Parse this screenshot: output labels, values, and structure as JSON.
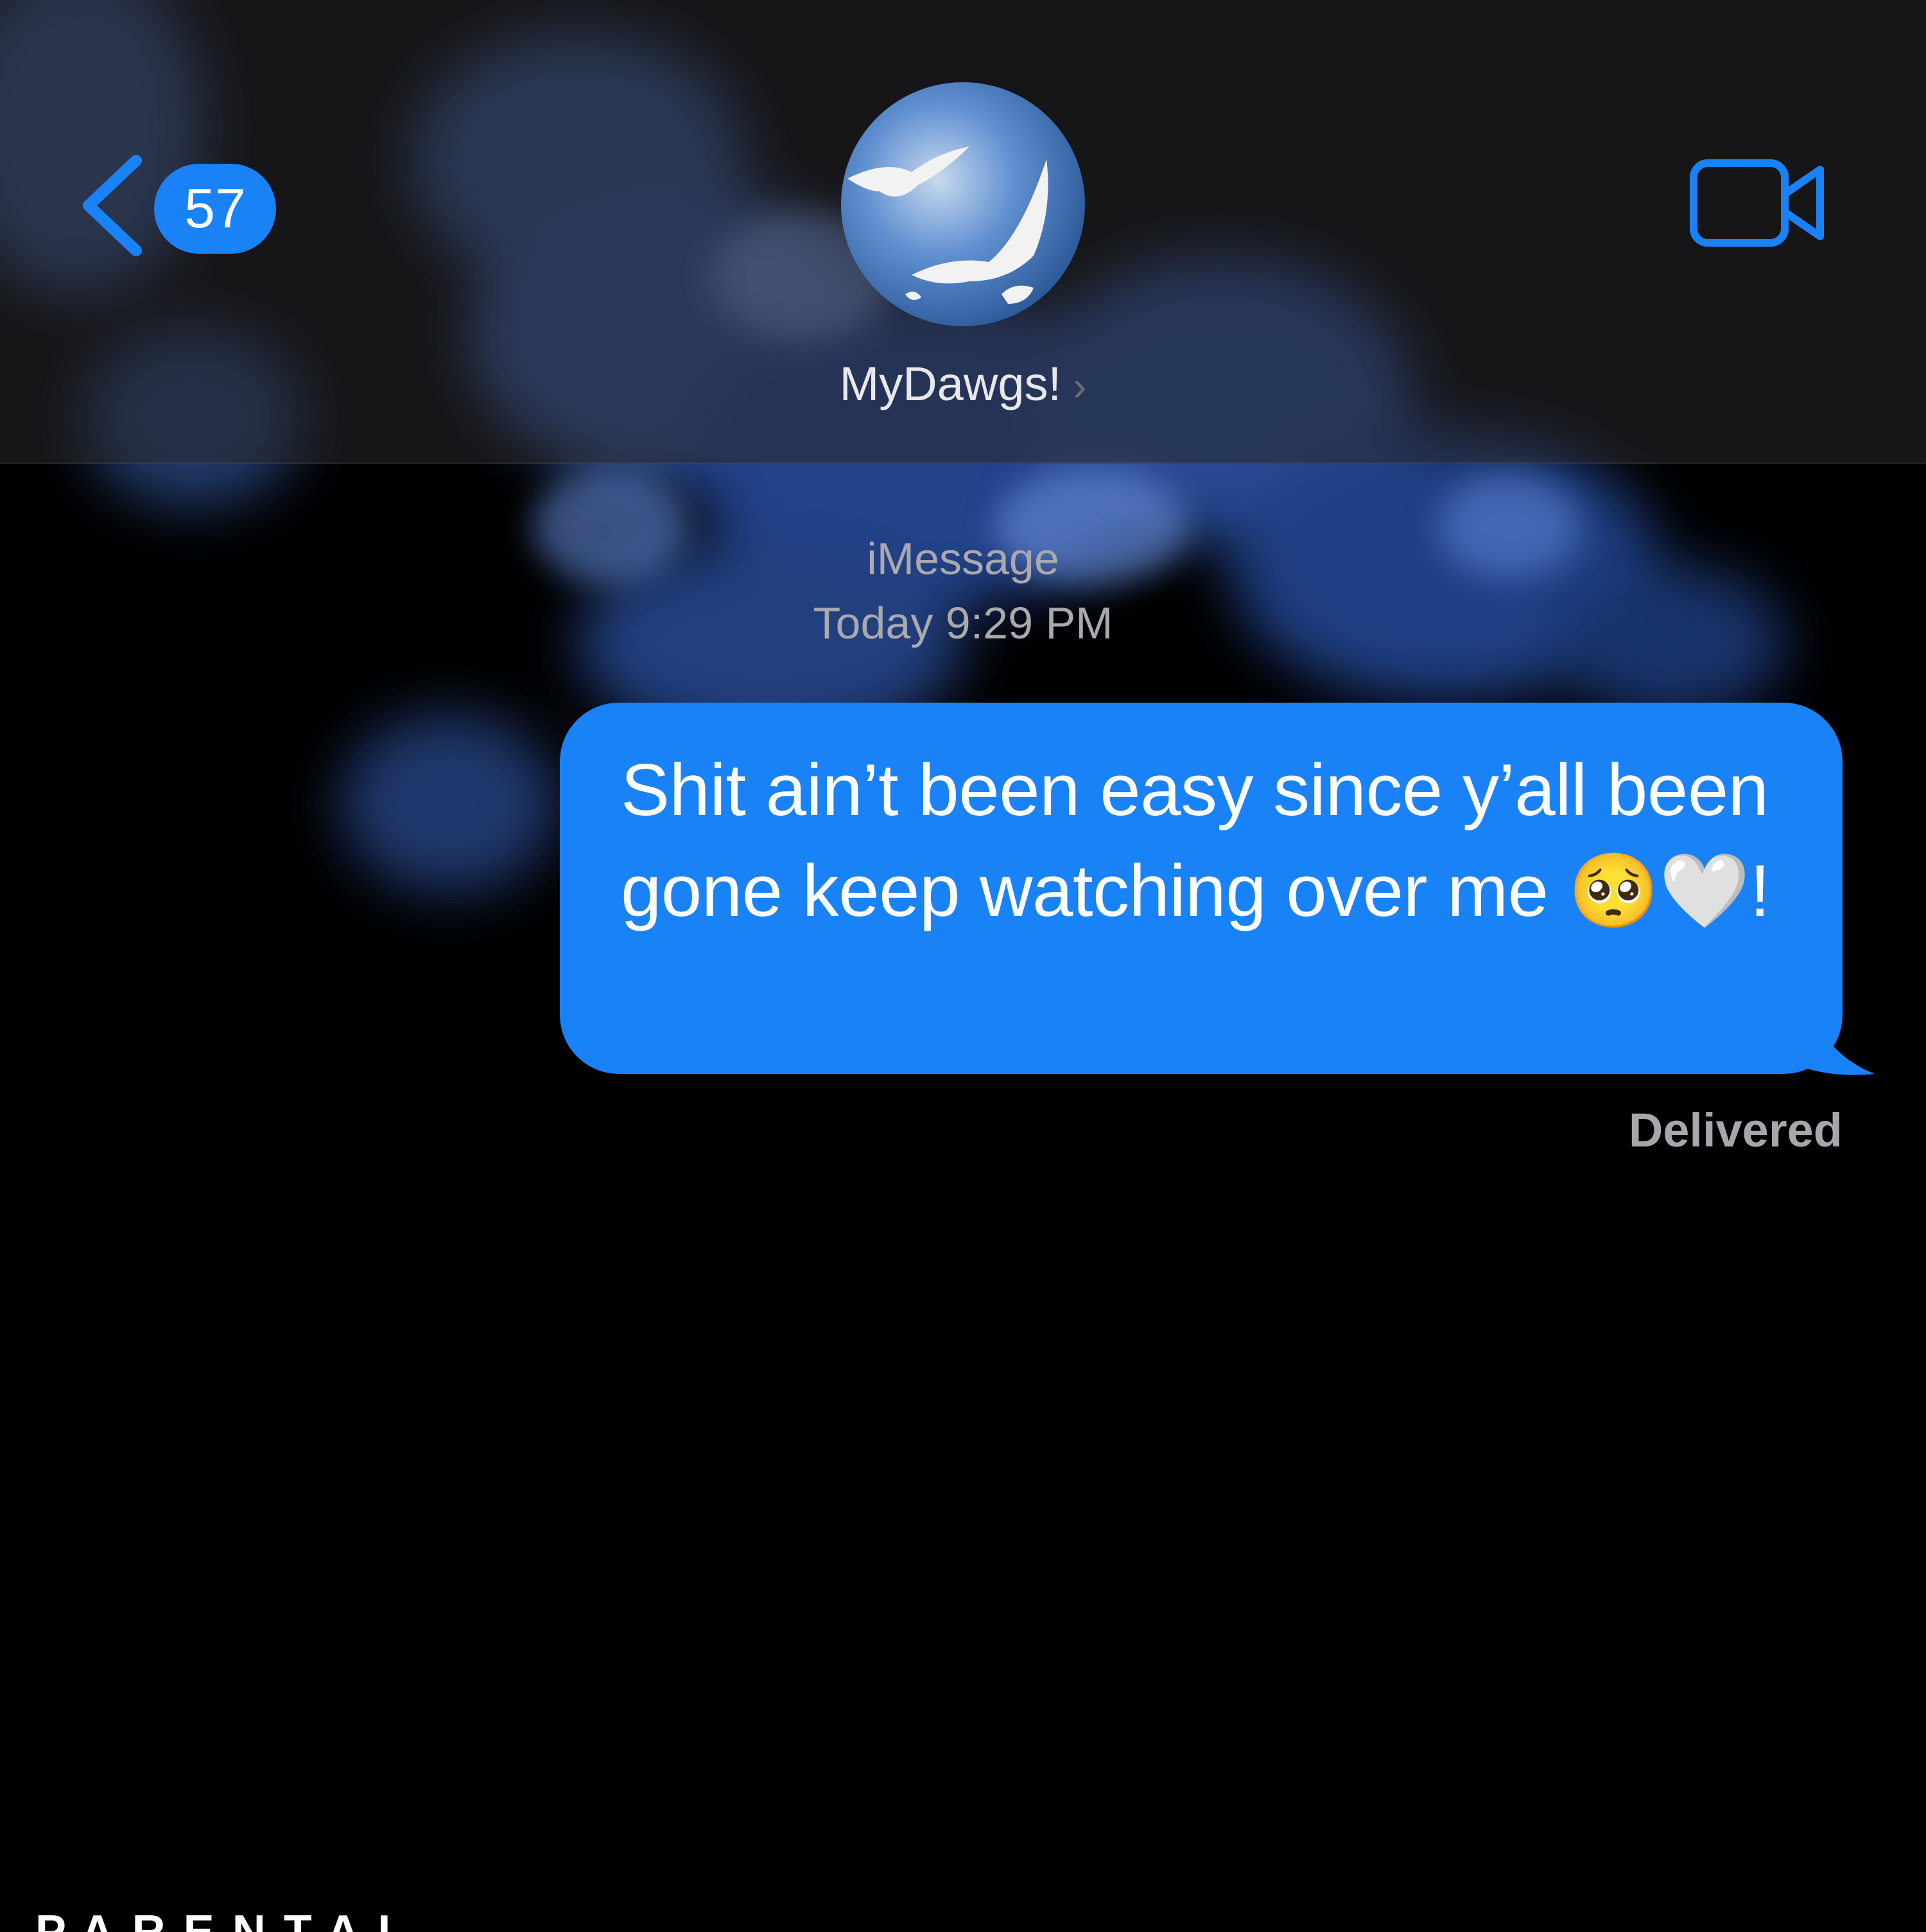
{
  "colors": {
    "background": "#000000",
    "accent": "#1a82f7",
    "header": "#28282c",
    "secondary_text": "#a9a9ae"
  },
  "header": {
    "back_badge_count": "57",
    "back_icon": "chevron-left-icon",
    "group_name": "MyDawgs!",
    "group_chevron": "›",
    "video_icon": "video-camera-icon",
    "avatar_image": "doves-in-sky"
  },
  "conversation": {
    "service_label": "iMessage",
    "timestamp": "Today 9:29 PM",
    "messages": [
      {
        "direction": "sent",
        "text": "Shit ain’t been easy since y’all been gone keep watching over me 🥺🤍!",
        "status": "Delivered"
      }
    ]
  },
  "footer": {
    "advisory_text": "PARENTAL"
  }
}
